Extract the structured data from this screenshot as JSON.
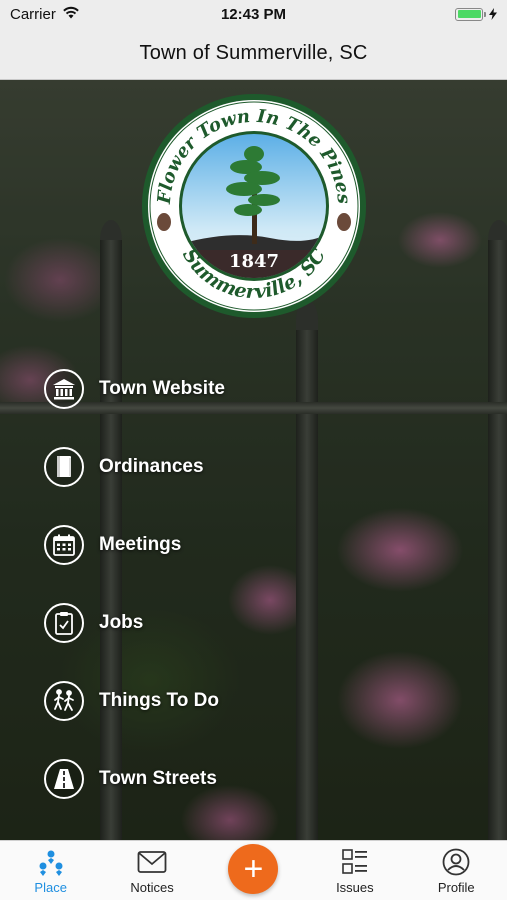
{
  "status": {
    "carrier": "Carrier",
    "time": "12:43 PM",
    "battery_level": 1.0
  },
  "nav": {
    "title": "Town of Summerville, SC"
  },
  "seal": {
    "top_text": "Flower Town In The Pines",
    "bottom_text": "Summerville, SC",
    "year": "1847"
  },
  "menu": [
    {
      "label": "Town Website",
      "icon": "building-icon"
    },
    {
      "label": "Ordinances",
      "icon": "book-icon"
    },
    {
      "label": "Meetings",
      "icon": "calendar-icon"
    },
    {
      "label": "Jobs",
      "icon": "clipboard-icon"
    },
    {
      "label": "Things To Do",
      "icon": "people-walking-icon"
    },
    {
      "label": "Town Streets",
      "icon": "road-icon"
    }
  ],
  "tabs": [
    {
      "label": "Place",
      "icon": "place-icon",
      "active": true
    },
    {
      "label": "Notices",
      "icon": "mail-icon",
      "active": false
    },
    {
      "label": "",
      "icon": "plus-icon",
      "active": false
    },
    {
      "label": "Issues",
      "icon": "issues-icon",
      "active": false
    },
    {
      "label": "Profile",
      "icon": "profile-icon",
      "active": false
    }
  ],
  "colors": {
    "accent": "#1f8fe0",
    "fab": "#ee6a1c",
    "seal_green": "#1e5a2c"
  }
}
